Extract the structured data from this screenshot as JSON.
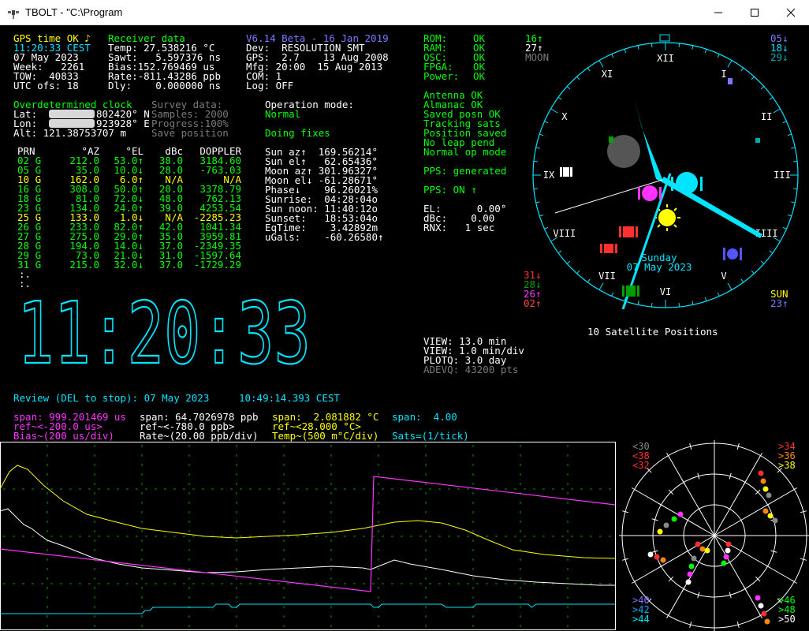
{
  "window": {
    "title": "TBOLT - \"C:\\Program",
    "icon": "satellite-app-icon"
  },
  "status": {
    "gps_time_ok": "GPS time OK ♪",
    "time_local": "11:20:33 CEST",
    "date": "07 May 2023",
    "week": "Week:   2261",
    "tow": "TOW:  40833",
    "utc_ofs": "UTC ofs: 18"
  },
  "receiver": {
    "header": "Receiver data",
    "temp": "Temp: 27.538216 °C",
    "sawt": "Sawt:   5.597376 ns",
    "bias": "Bias:152.769469 us",
    "rate": "Rate:-811.43286 ppb",
    "dly": "Dly:    0.000000 ns"
  },
  "version": {
    "header": "V6.14 Beta - 16 Jan 2019",
    "dev": "Dev:  RESOLUTION SMT",
    "gps": "GPS:  2.7    13 Aug 2008",
    "mfg": "Mfg: 20:00  15 Aug 2013",
    "com": "COM: 1",
    "log": "Log: OFF"
  },
  "health": {
    "items": [
      {
        "label": "ROM:",
        "value": "OK"
      },
      {
        "label": "RAM:",
        "value": "OK"
      },
      {
        "label": "OSC:",
        "value": "OK"
      },
      {
        "label": "FPGA:",
        "value": "OK"
      },
      {
        "label": "Power:",
        "value": "OK"
      }
    ]
  },
  "sky_left_top": [
    "16↑",
    "27↑",
    "MOON"
  ],
  "sky_right_top": [
    "05↓",
    "18↓",
    "29↓"
  ],
  "sky_left_bottom": [
    "31↓",
    "28↓",
    "26↑",
    "02↑"
  ],
  "sky_right_bottom": [
    "SUN",
    "23↑"
  ],
  "position": {
    "header": "Overdetermined clock",
    "lat_label": "Lat:",
    "lat_value": "802420° N",
    "lon_label": "Lon:",
    "lon_value": "923928° E",
    "alt": "Alt: 121.38753707 m"
  },
  "survey": {
    "header": "Survey data:",
    "samples": "Samples: 2000",
    "progress": "Progress:100%",
    "save": "Save position"
  },
  "operation": {
    "label": "Operation mode:",
    "mode": "Normal",
    "fixes": "Doing fixes"
  },
  "status_msgs": [
    "Antenna OK",
    "Almanac OK",
    "Saved posn OK",
    "Tracking sats",
    "Position saved",
    "No leap pend",
    "Normal op mode"
  ],
  "pps_generated": "PPS: generated",
  "pps_on": "PPS: ON ↑",
  "masks": {
    "el": "EL:      0.00°",
    "dbc": "dBc:    0.00",
    "rnx": "RNX:   1 sec"
  },
  "prn_table": {
    "headers": [
      "PRN",
      "°AZ",
      "°EL",
      "dBc",
      "DOPPLER"
    ],
    "rows": [
      {
        "prn": "02 G",
        "az": "212.0",
        "el": "53.0↑",
        "dbc": "38.0",
        "dop": "3184.60",
        "color": "#00ff00"
      },
      {
        "prn": "05 G",
        "az": "35.0",
        "el": "10.0↓",
        "dbc": "28.0",
        "dop": "-763.03",
        "color": "#00ff00"
      },
      {
        "prn": "10 G",
        "az": "162.0",
        "el": "6.0↑",
        "dbc": "N/A",
        "dop": "N/A",
        "color": "#ffff00"
      },
      {
        "prn": "16 G",
        "az": "308.0",
        "el": "50.0↑",
        "dbc": "20.0",
        "dop": "3378.79",
        "color": "#00ff00"
      },
      {
        "prn": "18 G",
        "az": "81.0",
        "el": "72.0↓",
        "dbc": "48.0",
        "dop": "762.13",
        "color": "#00ff00"
      },
      {
        "prn": "23 G",
        "az": "134.0",
        "el": "24.0↑",
        "dbc": "39.0",
        "dop": "4253.54",
        "color": "#00ff00"
      },
      {
        "prn": "25 G",
        "az": "133.0",
        "el": "1.0↓",
        "dbc": "N/A",
        "dop": "-2285.23",
        "color": "#ffff00"
      },
      {
        "prn": "26 G",
        "az": "233.0",
        "el": "82.0↑",
        "dbc": "42.0",
        "dop": "1041.34",
        "color": "#00ff00"
      },
      {
        "prn": "27 G",
        "az": "275.0",
        "el": "29.0↑",
        "dbc": "35.0",
        "dop": "3959.81",
        "color": "#00ff00"
      },
      {
        "prn": "28 G",
        "az": "194.0",
        "el": "14.0↓",
        "dbc": "37.0",
        "dop": "-2349.35",
        "color": "#00ff00"
      },
      {
        "prn": "29 G",
        "az": "73.0",
        "el": "21.0↓",
        "dbc": "31.0",
        "dop": "-1597.64",
        "color": "#00ff00"
      },
      {
        "prn": "31 G",
        "az": "215.0",
        "el": "32.0↓",
        "dbc": "37.0",
        "dop": "-1729.29",
        "color": "#00ff00"
      }
    ],
    "more": [
      ":.",
      ":."
    ]
  },
  "sun_moon": [
    "Sun az↑  169.56214°",
    "Sun el↑   62.65436°",
    "Moon az↑ 301.96327°",
    "Moon el↓ -61.28671°",
    "Phase↓    96.26021%",
    "Sunrise:  04:28:04o",
    "Sun noon: 11:40:12o",
    "Sunset:   18:53:04o",
    "EqTime:    3.42892m",
    "uGals:    -60.26580↑"
  ],
  "big_clock": "11:20:33",
  "sky": {
    "day": "Sunday",
    "date": "07 May 2023",
    "caption": "10 Satellite Positions",
    "hour_labels": [
      "XII",
      "I",
      "II",
      "III",
      "IIII",
      "V",
      "VI",
      "VII",
      "VIII",
      "IX",
      "X",
      "XI"
    ]
  },
  "view": {
    "view1": "VIEW: 13.0 min",
    "view2": "VIEW: 1.0 min/div",
    "plotq": "PLOTQ: 3.0 day",
    "adevq": "ADEVQ: 43200 pts"
  },
  "review": "Review (DEL to stop): 07 May 2023     10:49:14.393 CEST",
  "plot_legend": {
    "bias_span": "span: 999.201469 us",
    "bias_ref": "ref~<-200.0 us>",
    "bias_scale": "Bias~(200 us/div)",
    "rate_span": "span: 64.7026978 ppb",
    "rate_ref": "ref~<-780.0 ppb>",
    "rate_scale": "Rate~(20.00 ppb/div)",
    "temp_span": "span:  2.081882 °C",
    "temp_ref": "ref~<28.000 °C>",
    "temp_scale": "Temp~(500 m°C/div)",
    "sats_span": "span:  4.00",
    "sats_scale": "Sats=(1/tick)"
  },
  "mini_labels": {
    "tl": [
      "<30",
      "<38",
      "<32"
    ],
    "tr": [
      ">34",
      ">36",
      ">38"
    ],
    "bl": [
      ">40",
      ">42",
      ">44"
    ],
    "br": [
      ">46",
      ">48",
      ">50"
    ]
  },
  "colors": {
    "bias": "#ff33ff",
    "rate": "#ffffff",
    "temp": "#ffff00",
    "sats": "#00e5ff",
    "grid": "#009900",
    "accent": "#00e5ff"
  }
}
